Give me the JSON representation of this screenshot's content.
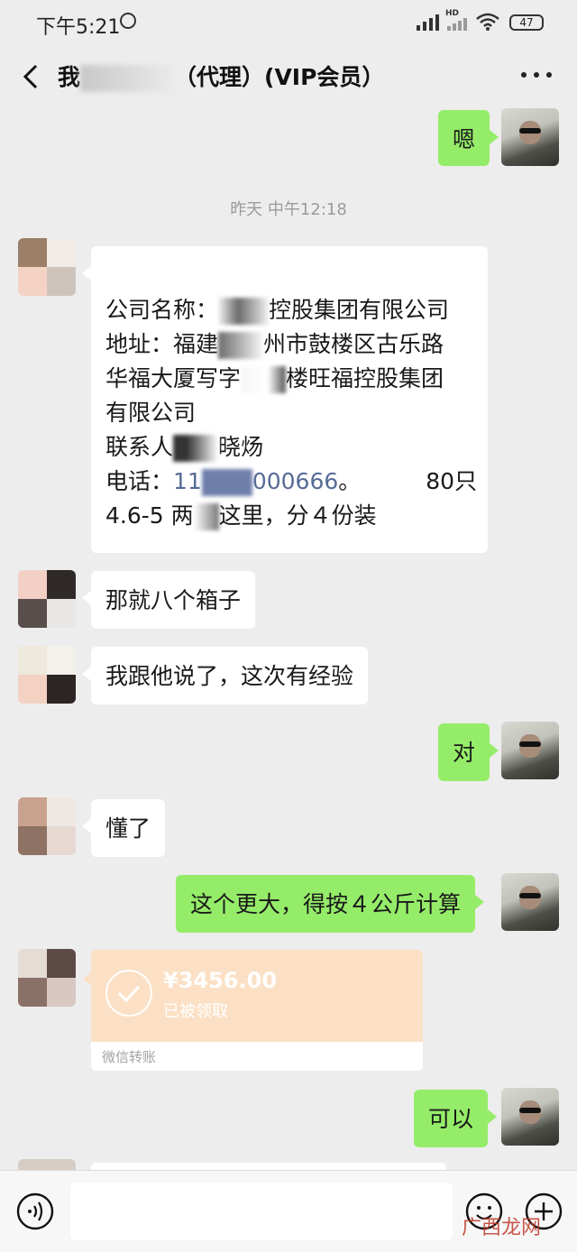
{
  "status_bar": {
    "time": "下午5:21",
    "network": "HD",
    "battery": "47"
  },
  "header": {
    "title_prefix": "我",
    "title_suffix": "（代理）(VIP会员）"
  },
  "timestamp": "昨天 中午12:18",
  "messages": [
    {
      "sender": "self",
      "text": "嗯"
    },
    {
      "sender": "other",
      "lines": [
        "公司名称：",
        "控股集团有限公司",
        "地址：福建",
        "州市鼓楼区古乐路",
        "华福大厦写字",
        "楼旺福控股集团",
        "有限公司",
        "联系人",
        "晓炀",
        "电话：",
        "11",
        "000666",
        "。",
        "80只",
        "4.6-5 两",
        "这里，分４份装"
      ]
    },
    {
      "sender": "other",
      "text": "那就八个箱子"
    },
    {
      "sender": "other",
      "text": "我跟他说了，这次有经验"
    },
    {
      "sender": "self",
      "text": "对"
    },
    {
      "sender": "other",
      "text": "懂了"
    },
    {
      "sender": "self",
      "text": "这个更大，得按４公斤计算"
    },
    {
      "sender": "other",
      "type": "transfer",
      "amount": "¥3456.00",
      "status": "已被领取",
      "label": "微信转账"
    },
    {
      "sender": "self",
      "text": "可以"
    }
  ],
  "watermark": "广西龙网",
  "colors": {
    "self_bubble": "#95ec69",
    "other_bubble": "#ffffff",
    "transfer": "#fbe0c5",
    "background": "#ededed",
    "link": "#576b95"
  },
  "icons": [
    "back-icon",
    "more-icon",
    "voice-icon",
    "emoji-icon",
    "plus-icon",
    "check-icon",
    "alarm-icon",
    "wifi-icon",
    "signal-icon",
    "battery-icon"
  ]
}
